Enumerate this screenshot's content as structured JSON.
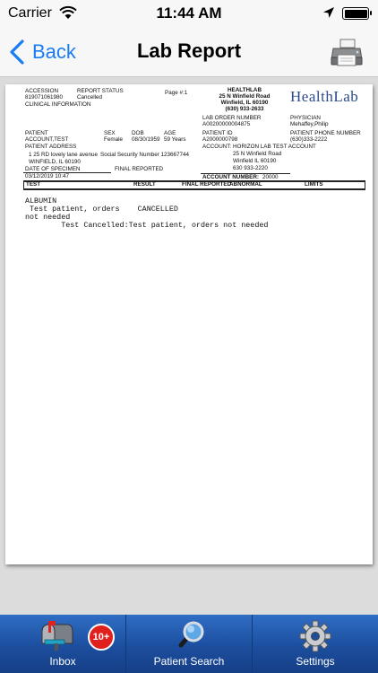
{
  "status_bar": {
    "carrier": "Carrier",
    "time": "11:44 AM"
  },
  "nav": {
    "back_label": "Back",
    "title": "Lab Report"
  },
  "report": {
    "accession_label": "ACCESSION",
    "accession_value": "819071061980",
    "report_status_label": "REPORT STATUS",
    "report_status_value": "Cancelled",
    "clinical_info_label": "CLINICAL INFORMATION",
    "page_label": "Page #:1",
    "lab_name": "HEALTHLAB",
    "lab_address1": "25 N Winfield Road",
    "lab_address2": "Winfield, IL 60190",
    "lab_phone": "(630) 933-2633",
    "logo_text": "HealthLab",
    "lab_order_number_label": "LAB ORDER NUMBER",
    "lab_order_number_value": "A00200000004875",
    "physician_label": "PHYSICIAN",
    "physician_value": "Mehaffey,Philip",
    "patient_label": "PATIENT",
    "patient_value": "ACCOUNT,TEST",
    "sex_label": "SEX",
    "sex_value": "Female",
    "dob_label": "DOB",
    "dob_value": "08/30/1959",
    "age_label": "AGE",
    "age_value": "59 Years",
    "patient_id_label": "PATIENT ID",
    "patient_id_value": "A2000000798",
    "patient_phone_label": "PATIENT PHONE NUMBER",
    "patient_phone_value": "(630)333-2222",
    "patient_address_label": "PATIENT ADDRESS",
    "patient_address1": "1 25 RD lovely lane avenue",
    "ssn_text": "Social Security Number 123667744",
    "patient_address2": "WINFIELD, IL 60190",
    "account_label": "ACCOUNT:",
    "account_name": "HORIZON LAB TEST ACCOUNT",
    "account_address1": "25 N Winfield Road",
    "account_address2": "Winfield IL 60190",
    "account_phone": "630 933-2220",
    "date_of_specimen_label": "DATE OF SPECIMEN",
    "date_of_specimen_value": "03/12/2019 10:47",
    "final_reported_label": "FINAL REPORTED",
    "account_number_label": "ACCOUNT NUMBER:",
    "account_number_value": "20000",
    "columns": {
      "test": "TEST",
      "result": "RESULT",
      "final_reported": "FINAL REPORTED",
      "abnormal": "ABNORMAL",
      "limits": "LIMITS"
    },
    "body_line1": "ALBUMIN",
    "body_line2": " Test patient, orders    CANCELLED",
    "body_line3": "not needed",
    "body_line4": "        Test Cancelled:Test patient, orders not needed"
  },
  "tabs": {
    "inbox_label": "Inbox",
    "inbox_badge": "10+",
    "search_label": "Patient Search",
    "settings_label": "Settings"
  },
  "colors": {
    "accent": "#1a7cf5",
    "tab_bar": "#1c4e9e",
    "badge": "#e0201d",
    "logo": "#2b4a8a"
  }
}
